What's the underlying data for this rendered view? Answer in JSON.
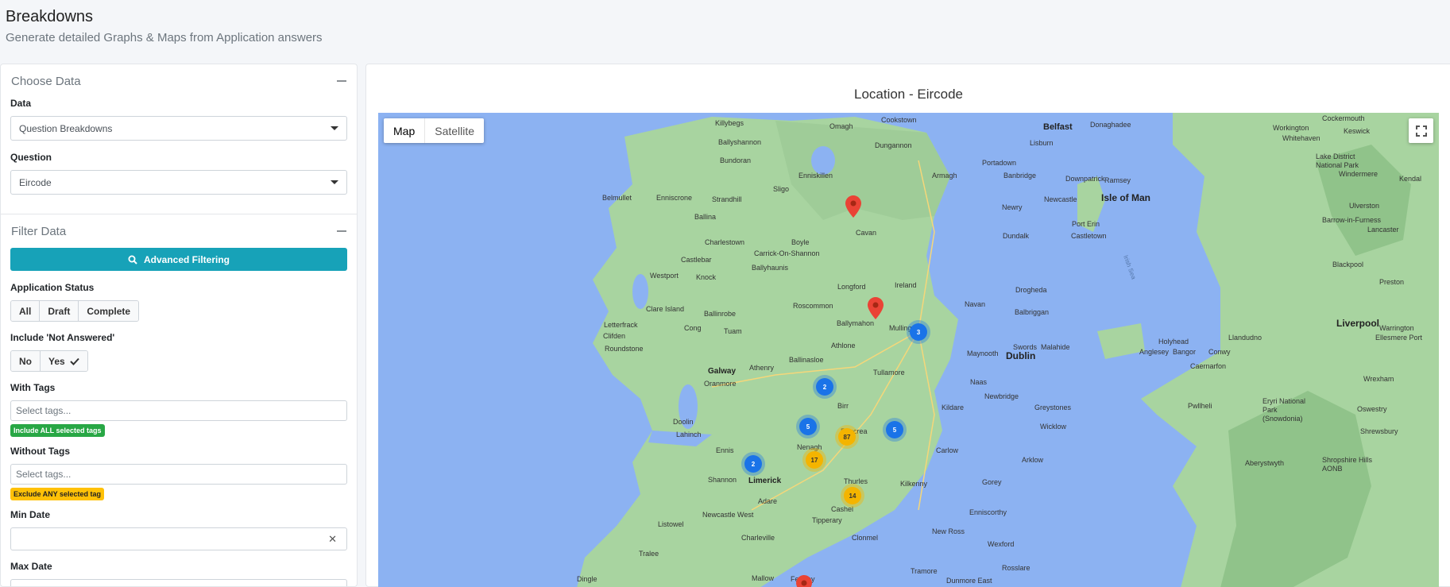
{
  "header": {
    "title": "Breakdowns",
    "subtitle": "Generate detailed Graphs & Maps from Application answers"
  },
  "choose_data": {
    "title": "Choose Data",
    "data_label": "Data",
    "data_value": "Question Breakdowns",
    "question_label": "Question",
    "question_value": "Eircode"
  },
  "filter_data": {
    "title": "Filter Data",
    "advanced_button": "Advanced Filtering",
    "status_label": "Application Status",
    "status_options": [
      "All",
      "Draft",
      "Complete"
    ],
    "not_answered_label": "Include 'Not Answered'",
    "not_answered_options": [
      "No",
      "Yes"
    ],
    "not_answered_selected": "Yes",
    "with_tags_label": "With Tags",
    "with_tags_placeholder": "Select tags...",
    "with_tags_badge": "Include ALL selected tags",
    "without_tags_label": "Without Tags",
    "without_tags_placeholder": "Select tags...",
    "without_tags_badge": "Exclude ANY selected tag",
    "min_date_label": "Min Date",
    "max_date_label": "Max Date"
  },
  "map": {
    "title": "Location - Eircode",
    "map_type_options": [
      "Map",
      "Satellite"
    ],
    "map_type_selected": "Map",
    "towns": [
      "Killybegs",
      "Omagh",
      "Cookstown",
      "Belfast",
      "Donaghadee",
      "Ballyshannon",
      "Dungannon",
      "Lisburn",
      "Bundoran",
      "Enniskillen",
      "Portadown",
      "Armagh",
      "Banbridge",
      "Downpatrick",
      "Belmullet",
      "Enniscrone",
      "Strandhill",
      "Sligo",
      "Newcastle",
      "Newry",
      "Ballina",
      "Cavan",
      "Dundalk",
      "Charlestown",
      "Boyle",
      "Castlebar",
      "Carrick-On-Shannon",
      "Westport",
      "Knock",
      "Ballyhaunis",
      "Longford",
      "Drogheda",
      "Ireland",
      "Navan",
      "Balbriggan",
      "Roscommon",
      "Clare Island",
      "Ballinrobe",
      "Letterfrack",
      "Cong",
      "Tuam",
      "Ballymahon",
      "Mullingar",
      "Swords",
      "Clifden",
      "Malahide",
      "Roundstone",
      "Athlone",
      "Maynooth",
      "Dublin",
      "Ballinasloe",
      "Tullamore",
      "Galway",
      "Athenry",
      "Oranmore",
      "Naas",
      "Newbridge",
      "Greystones",
      "Birr",
      "Kildare",
      "Doolin",
      "Roscrea",
      "Wicklow",
      "Lahinch",
      "Ennis",
      "Nenagh",
      "Carlow",
      "Arklow",
      "Thurles",
      "Kilkenny",
      "Shannon",
      "Limerick",
      "Gorey",
      "Newcastle West",
      "Adare",
      "Cashel",
      "Enniscorthy",
      "Tipperary",
      "Listowel",
      "Clonmel",
      "New Ross",
      "Charleville",
      "Wexford",
      "Tralee",
      "Dingle",
      "Mallow",
      "Fermoy",
      "Tramore",
      "Dunmore East",
      "Rosslare",
      "Isle of Man",
      "Port Erin",
      "Castletown",
      "Ramsey",
      "Workington",
      "Cockermouth",
      "Keswick",
      "Whitehaven",
      "Lake District National Park",
      "Windermere",
      "Ulverston",
      "Barrow-in-Furness",
      "Lancaster",
      "Kendal",
      "Blackpool",
      "Preston",
      "Liverpool",
      "Warrington",
      "Llandudno",
      "Holyhead",
      "Anglesey",
      "Bangor",
      "Conwy",
      "Caernarfon",
      "Pwllheli",
      "Eryri National Park (Snowdonia)",
      "Wrexham",
      "Oswestry",
      "Shrewsbury",
      "Aberystwyth",
      "Shropshire Hills AONB",
      "Ellesmere Port",
      "Irish Sea"
    ],
    "clusters": [
      {
        "label": "3",
        "color": "blue"
      },
      {
        "label": "2",
        "color": "blue"
      },
      {
        "label": "5",
        "color": "blue"
      },
      {
        "label": "5",
        "color": "blue"
      },
      {
        "label": "2",
        "color": "blue"
      },
      {
        "label": "87",
        "color": "yellow"
      },
      {
        "label": "17",
        "color": "yellow"
      },
      {
        "label": "14",
        "color": "yellow"
      }
    ],
    "colors": {
      "water": "#8cb2f2",
      "land": "#a8d4a0",
      "land_dark": "#90c38a",
      "cluster_blue": "#1a73e8",
      "cluster_yellow": "#f4b400",
      "pin_red": "#ea4335"
    }
  }
}
